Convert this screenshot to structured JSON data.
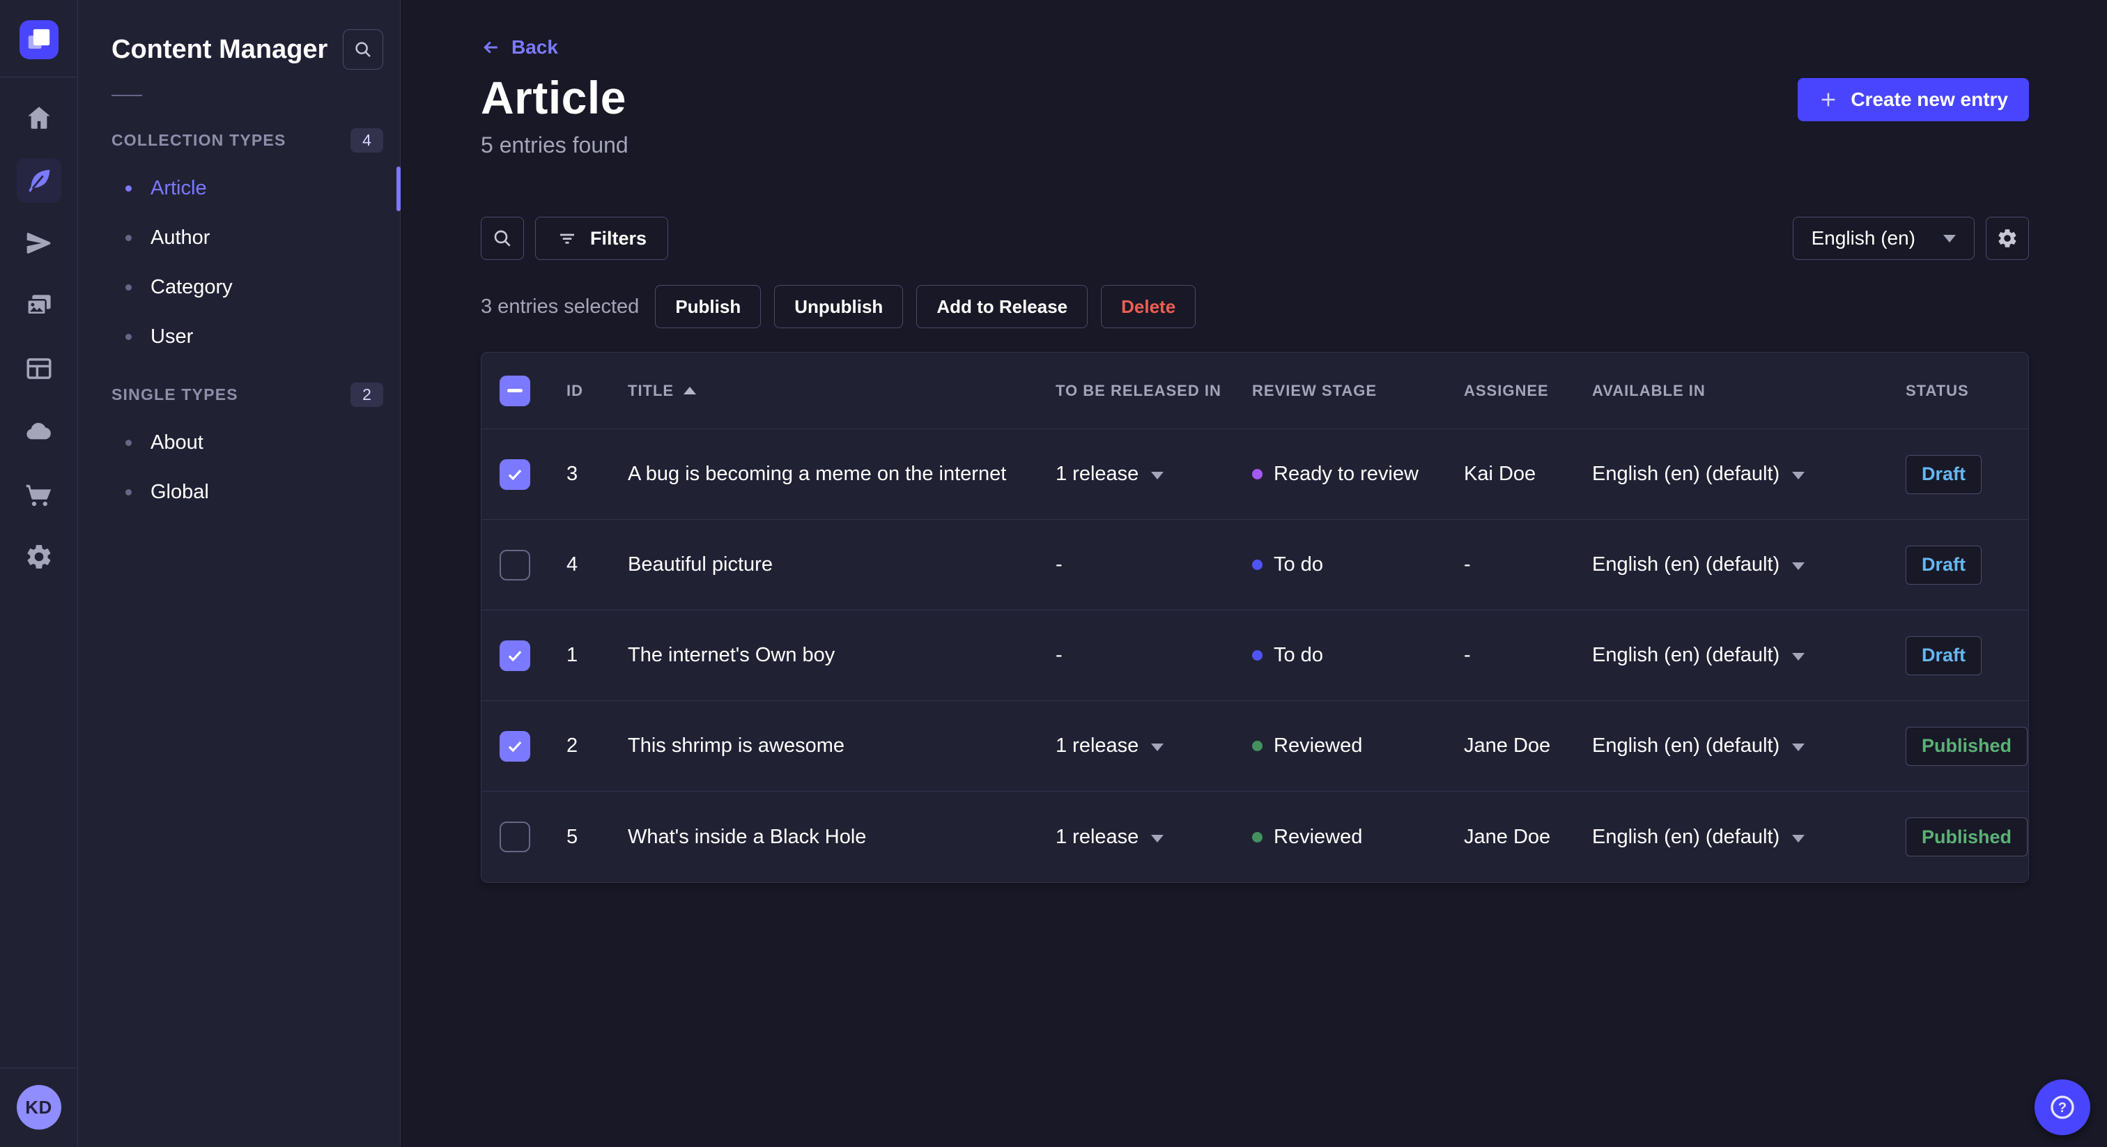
{
  "colors": {
    "background": "#181826",
    "panel": "#212134",
    "primary": "#4945ff",
    "primary_light": "#7b79ff",
    "danger": "#ee5e52",
    "draft_text": "#66b7f1",
    "published_text": "#5cb176",
    "stage_todo": "#4f54f5",
    "stage_ready": "#a25af2",
    "stage_reviewed": "#44915f"
  },
  "icons": {
    "logo": "strapi-logo",
    "rail": [
      "home-icon",
      "content-manager-feather-icon",
      "send-icon",
      "media-library-icon",
      "layout-icon",
      "cloud-icon",
      "cart-icon",
      "gear-icon"
    ],
    "search": "magnifier",
    "filter": "filter-lines",
    "plus": "plus",
    "back_arrow": "arrow-left",
    "chevron": "triangle-down",
    "sort": "triangle-up",
    "help": "question-mark-circle"
  },
  "sidebar": {
    "title": "Content Manager",
    "sections": [
      {
        "label": "COLLECTION TYPES",
        "count": "4",
        "items": [
          {
            "label": "Article"
          },
          {
            "label": "Author"
          },
          {
            "label": "Category"
          },
          {
            "label": "User"
          }
        ]
      },
      {
        "label": "SINGLE TYPES",
        "count": "2",
        "items": [
          {
            "label": "About"
          },
          {
            "label": "Global"
          }
        ]
      }
    ]
  },
  "user": {
    "initials": "KD"
  },
  "header": {
    "back": "Back",
    "title": "Article",
    "subtitle": "5 entries found",
    "create_button": "Create new entry"
  },
  "toolbar": {
    "filters_label": "Filters",
    "locale": "English (en)"
  },
  "selection": {
    "text": "3 entries selected",
    "publish": "Publish",
    "unpublish": "Unpublish",
    "add_to_release": "Add to Release",
    "delete": "Delete"
  },
  "table": {
    "headers": {
      "id": "ID",
      "title": "TITLE",
      "release": "TO BE RELEASED IN",
      "stage": "REVIEW STAGE",
      "assignee": "ASSIGNEE",
      "available": "AVAILABLE IN",
      "status": "STATUS"
    },
    "rows": [
      {
        "id": "3",
        "title": "A bug is becoming a meme on the internet",
        "release": "1 release",
        "stage": "Ready to review",
        "assignee": "Kai Doe",
        "available": "English (en) (default)",
        "status": "Draft",
        "selected": true
      },
      {
        "id": "4",
        "title": "Beautiful picture",
        "release": "-",
        "stage": "To do",
        "assignee": "-",
        "available": "English (en) (default)",
        "status": "Draft",
        "selected": false
      },
      {
        "id": "1",
        "title": "The internet's Own boy",
        "release": "-",
        "stage": "To do",
        "assignee": "-",
        "available": "English (en) (default)",
        "status": "Draft",
        "selected": true
      },
      {
        "id": "2",
        "title": "This shrimp is awesome",
        "release": "1 release",
        "stage": "Reviewed",
        "assignee": "Jane Doe",
        "available": "English (en) (default)",
        "status": "Published",
        "selected": true
      },
      {
        "id": "5",
        "title": "What's inside a Black Hole",
        "release": "1 release",
        "stage": "Reviewed",
        "assignee": "Jane Doe",
        "available": "English (en) (default)",
        "status": "Published",
        "selected": false
      }
    ]
  }
}
